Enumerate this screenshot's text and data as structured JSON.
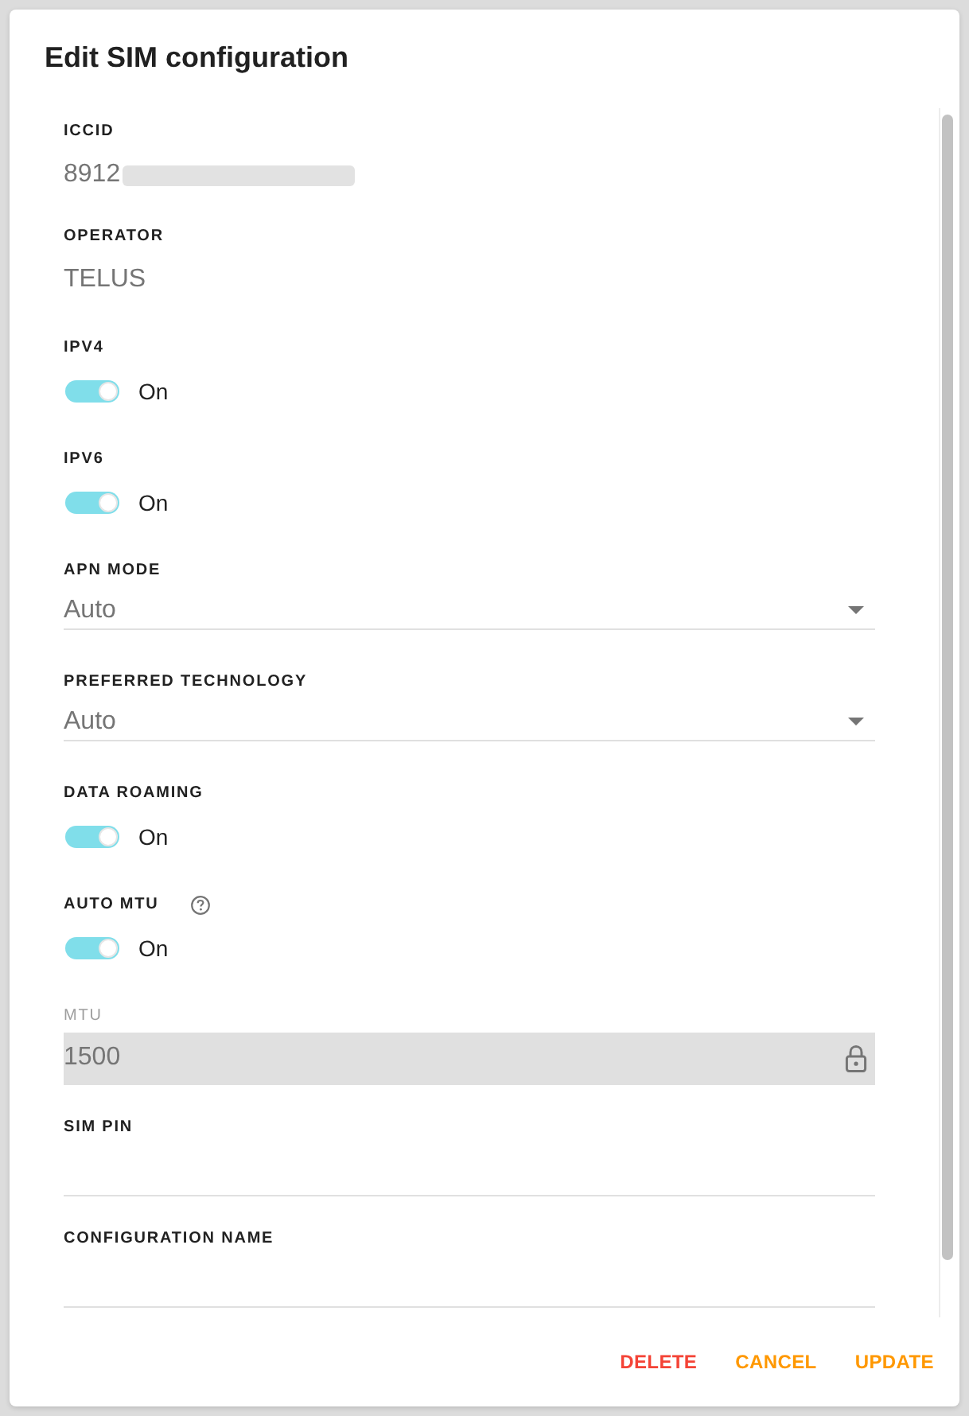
{
  "dialog": {
    "title": "Edit SIM configuration"
  },
  "fields": [
    {
      "kind": "text",
      "label": "ICCID",
      "value": "8912",
      "redacted": true
    },
    {
      "kind": "text",
      "label": "OPERATOR",
      "value": "TELUS"
    },
    {
      "kind": "switch",
      "label": "IPV4",
      "on": true,
      "state_label": "On"
    },
    {
      "kind": "switch",
      "label": "IPV6",
      "on": true,
      "state_label": "On"
    },
    {
      "kind": "select",
      "label": "APN MODE",
      "value": "Auto"
    },
    {
      "kind": "select",
      "label": "PREFERRED TECHNOLOGY",
      "value": "Auto"
    },
    {
      "kind": "switch",
      "label": "DATA ROAMING",
      "on": true,
      "state_label": "On"
    },
    {
      "kind": "switch",
      "label": "AUTO MTU",
      "on": true,
      "state_label": "On",
      "help": true
    },
    {
      "kind": "input",
      "label": "MTU",
      "value": "1500",
      "disabled": true
    },
    {
      "kind": "input",
      "label": "SIM PIN",
      "disabled": false
    },
    {
      "kind": "input",
      "label": "CONFIGURATION NAME",
      "disabled": false
    }
  ],
  "buttons": [
    {
      "label": "DELETE",
      "kind": "danger"
    },
    {
      "label": "CANCEL",
      "kind": "primary"
    },
    {
      "label": "UPDATE",
      "kind": "primary"
    }
  ]
}
